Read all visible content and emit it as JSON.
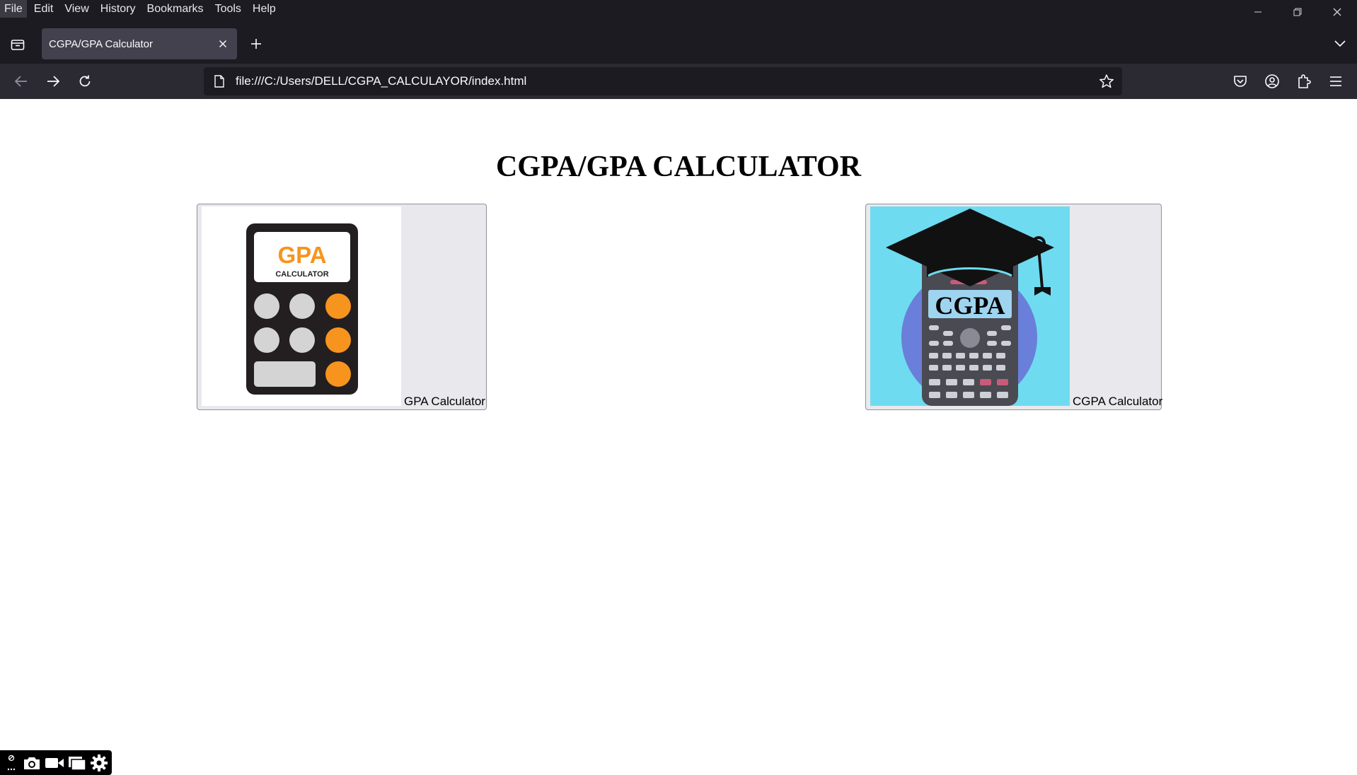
{
  "menubar": {
    "items": [
      {
        "label": "File"
      },
      {
        "label": "Edit"
      },
      {
        "label": "View"
      },
      {
        "label": "History"
      },
      {
        "label": "Bookmarks"
      },
      {
        "label": "Tools"
      },
      {
        "label": "Help"
      }
    ]
  },
  "tab": {
    "title": "CGPA/GPA Calculator"
  },
  "urlbar": {
    "url": "file:///C:/Users/DELL/CGPA_CALCULAYOR/index.html"
  },
  "page": {
    "title": "CGPA/GPA CALCULATOR",
    "cards": [
      {
        "label": "GPA Calculator",
        "image_text_main": "GPA",
        "image_text_sub": "CALCULATOR"
      },
      {
        "label": "CGPA Calculator",
        "image_text_main": "CGPA"
      }
    ]
  },
  "colors": {
    "chrome_bg": "#1c1b22",
    "navbar_bg": "#2b2a33",
    "tab_active": "#42414d",
    "gpa_orange": "#f7941d",
    "cgpa_bg": "#6fdbf0",
    "cgpa_circle": "#6a7fd9"
  }
}
